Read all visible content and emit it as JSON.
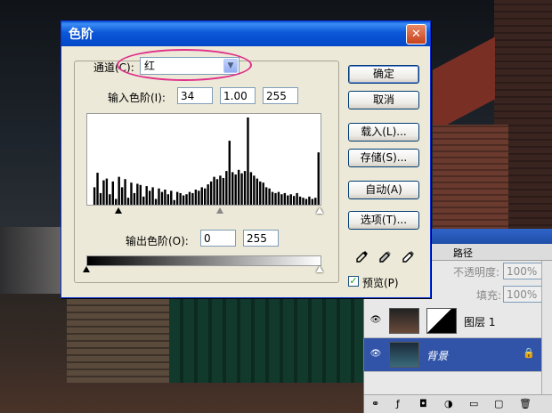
{
  "dialog": {
    "title": "色阶",
    "close_glyph": "✕",
    "channel_label": "通道(C):",
    "channel_value": "红",
    "input_levels_label": "输入色阶(I):",
    "input_black": "34",
    "input_gamma": "1.00",
    "input_white": "255",
    "output_levels_label": "输出色阶(O):",
    "output_black": "0",
    "output_white": "255",
    "buttons": {
      "ok": "确定",
      "cancel": "取消",
      "load": "载入(L)...",
      "save": "存储(S)...",
      "auto": "自动(A)",
      "options": "选项(T)..."
    },
    "preview_label": "预览(P)",
    "preview_checked": true,
    "histogram": [
      0,
      0,
      30,
      55,
      20,
      42,
      45,
      18,
      40,
      10,
      48,
      30,
      44,
      12,
      38,
      20,
      36,
      34,
      14,
      32,
      24,
      30,
      10,
      28,
      22,
      26,
      18,
      24,
      8,
      22,
      20,
      16,
      18,
      22,
      20,
      26,
      24,
      30,
      28,
      35,
      40,
      48,
      44,
      50,
      46,
      58,
      110,
      56,
      52,
      60,
      54,
      58,
      150,
      56,
      50,
      45,
      40,
      38,
      30,
      28,
      22,
      20,
      22,
      18,
      20,
      16,
      18,
      15,
      20,
      14,
      12,
      10,
      14,
      10,
      12,
      90
    ]
  },
  "layers_panel": {
    "tab_paths": "路径",
    "opacity_label": "不透明度:",
    "opacity_value": "100%",
    "fill_label": "填充:",
    "fill_value": "100%",
    "layers": [
      {
        "name": "图层 1",
        "selected": false
      },
      {
        "name": "背景",
        "selected": true
      }
    ]
  },
  "colors": {
    "titlebar": "#0b58d8",
    "dialog_bg": "#ece9d8",
    "highlight_circle": "#e0308a",
    "selected_layer": "#3154a8"
  }
}
